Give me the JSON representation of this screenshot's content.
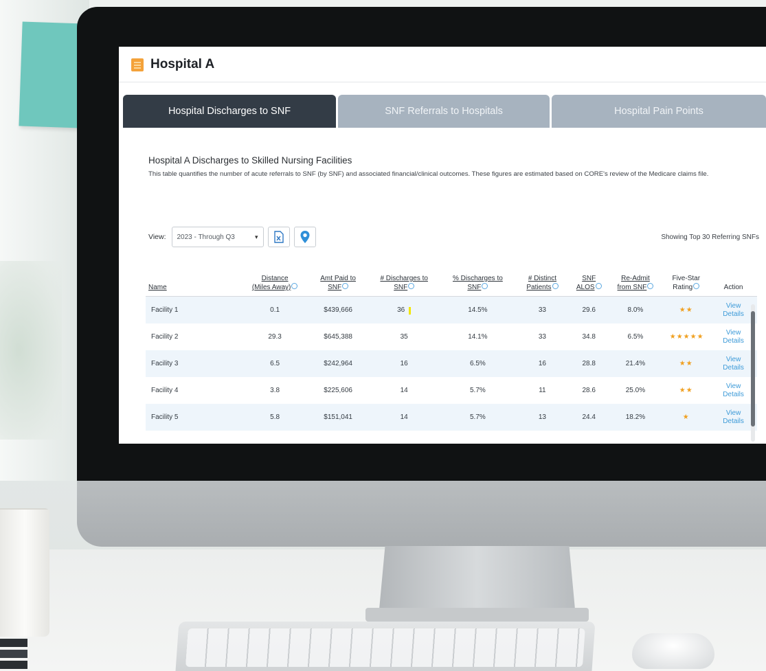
{
  "app": {
    "title": "Hospital A"
  },
  "tabs": [
    {
      "label": "Hospital Discharges to SNF",
      "active": true
    },
    {
      "label": "SNF Referrals to Hospitals",
      "active": false
    },
    {
      "label": "Hospital Pain Points",
      "active": false
    }
  ],
  "section": {
    "title": "Hospital A Discharges to Skilled Nursing Facilities",
    "description": "This table quantifies the number of acute referrals to SNF (by SNF) and associated financial/clinical outcomes. These figures are estimated based on CORE's review of the Medicare claims file."
  },
  "controls": {
    "view_label": "View:",
    "view_value": "2023 - Through Q3",
    "export_icon": "excel-export-icon",
    "map_icon": "map-pin-icon",
    "showing": "Showing Top 30 Referring SNFs"
  },
  "table": {
    "headers": {
      "name": "Name",
      "distance_1": "Distance",
      "distance_2": "(Miles Away)",
      "amt_1": "Amt Paid to",
      "amt_2": "SNF",
      "disc_1": "# Discharges to",
      "disc_2": "SNF",
      "pct_1": "% Discharges to",
      "pct_2": "SNF",
      "distinct_1": "# Distinct",
      "distinct_2": "Patients",
      "alos_1": "SNF",
      "alos_2": "ALOS",
      "readmit_1": "Re-Admit",
      "readmit_2": "from SNF",
      "rating_1": "Five-Star",
      "rating_2": "Rating",
      "action": "Action"
    },
    "rows": [
      {
        "name": "Facility 1",
        "distance": "0.1",
        "amt": "$439,666",
        "discharges": "36",
        "pct": "14.5%",
        "distinct": "33",
        "alos": "29.6",
        "readmit": "8.0%",
        "stars": "★★",
        "rating": 2,
        "action_1": "View",
        "action_2": "Details"
      },
      {
        "name": "Facility 2",
        "distance": "29.3",
        "amt": "$645,388",
        "discharges": "35",
        "pct": "14.1%",
        "distinct": "33",
        "alos": "34.8",
        "readmit": "6.5%",
        "stars": "★★★★★",
        "rating": 5,
        "action_1": "View",
        "action_2": "Details"
      },
      {
        "name": "Facility 3",
        "distance": "6.5",
        "amt": "$242,964",
        "discharges": "16",
        "pct": "6.5%",
        "distinct": "16",
        "alos": "28.8",
        "readmit": "21.4%",
        "stars": "★★",
        "rating": 2,
        "action_1": "View",
        "action_2": "Details"
      },
      {
        "name": "Facility 4",
        "distance": "3.8",
        "amt": "$225,606",
        "discharges": "14",
        "pct": "5.7%",
        "distinct": "11",
        "alos": "28.6",
        "readmit": "25.0%",
        "stars": "★★",
        "rating": 2,
        "action_1": "View",
        "action_2": "Details"
      },
      {
        "name": "Facility 5",
        "distance": "5.8",
        "amt": "$151,041",
        "discharges": "14",
        "pct": "5.7%",
        "distinct": "13",
        "alos": "24.4",
        "readmit": "18.2%",
        "stars": "★",
        "rating": 1,
        "action_1": "View",
        "action_2": "Details"
      }
    ]
  },
  "colors": {
    "active_tab": "#333c46",
    "inactive_tab": "#a7b3bf",
    "accent": "#3c9ad8",
    "star": "#f0a020",
    "sticky_note": "#6fc7bd"
  }
}
